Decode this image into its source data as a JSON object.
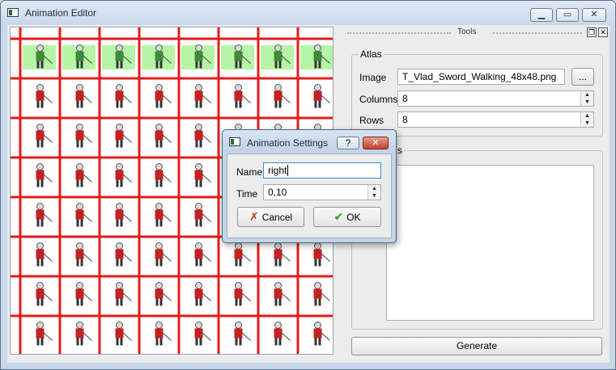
{
  "window": {
    "title": "Animation Editor",
    "controls": {
      "minimize_icon": "minimize-icon",
      "maximize_icon": "maximize-icon",
      "close_icon": "close-icon"
    }
  },
  "canvas": {
    "grid_columns": 8,
    "grid_rows": 8,
    "grid_line_color": "#e11d1d",
    "highlight_color": "#b6f5a6",
    "highlighted_row": 1
  },
  "tools": {
    "dock_title": "Tools",
    "atlas": {
      "title": "Atlas",
      "image_label": "Image",
      "image_value": "T_Vlad_Sword_Walking_48x48.png",
      "browse_label": "...",
      "columns_label": "Columns",
      "columns_value": "8",
      "rows_label": "Rows",
      "rows_value": "8"
    },
    "animations": {
      "title_visible": "s"
    },
    "generate_label": "Generate"
  },
  "dialog": {
    "title": "Animation Settings",
    "help_label": "?",
    "name_label": "Name",
    "name_value": "right",
    "time_label": "Time",
    "time_value": "0,10",
    "cancel_label": "Cancel",
    "ok_label": "OK"
  },
  "colors": {
    "accent_red": "#e11d1d",
    "ok_check": "#3a8f2b",
    "cancel_x": "#c0392b"
  }
}
